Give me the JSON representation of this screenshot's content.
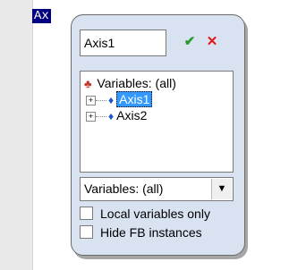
{
  "editor": {
    "token": "Ax"
  },
  "popup": {
    "search_value": "Axis1",
    "ok_glyph": "✔",
    "cancel_glyph": "✕",
    "tree": {
      "root_label": "Variables: (all)",
      "root_icon": "variables-icon",
      "items": [
        {
          "label": "Axis1",
          "selected": true,
          "icon": "variable-icon"
        },
        {
          "label": "Axis2",
          "selected": false,
          "icon": "variable-icon"
        }
      ]
    },
    "scope_value": "Variables: (all)",
    "local_label": "Local variables only",
    "local_checked": false,
    "hide_fb_label": "Hide FB instances",
    "hide_fb_checked": false
  },
  "colors": {
    "accent": "#3399ff",
    "ok": "#2c9a2c",
    "cancel": "#e01818",
    "popup_bg": "#d8e2f0"
  }
}
